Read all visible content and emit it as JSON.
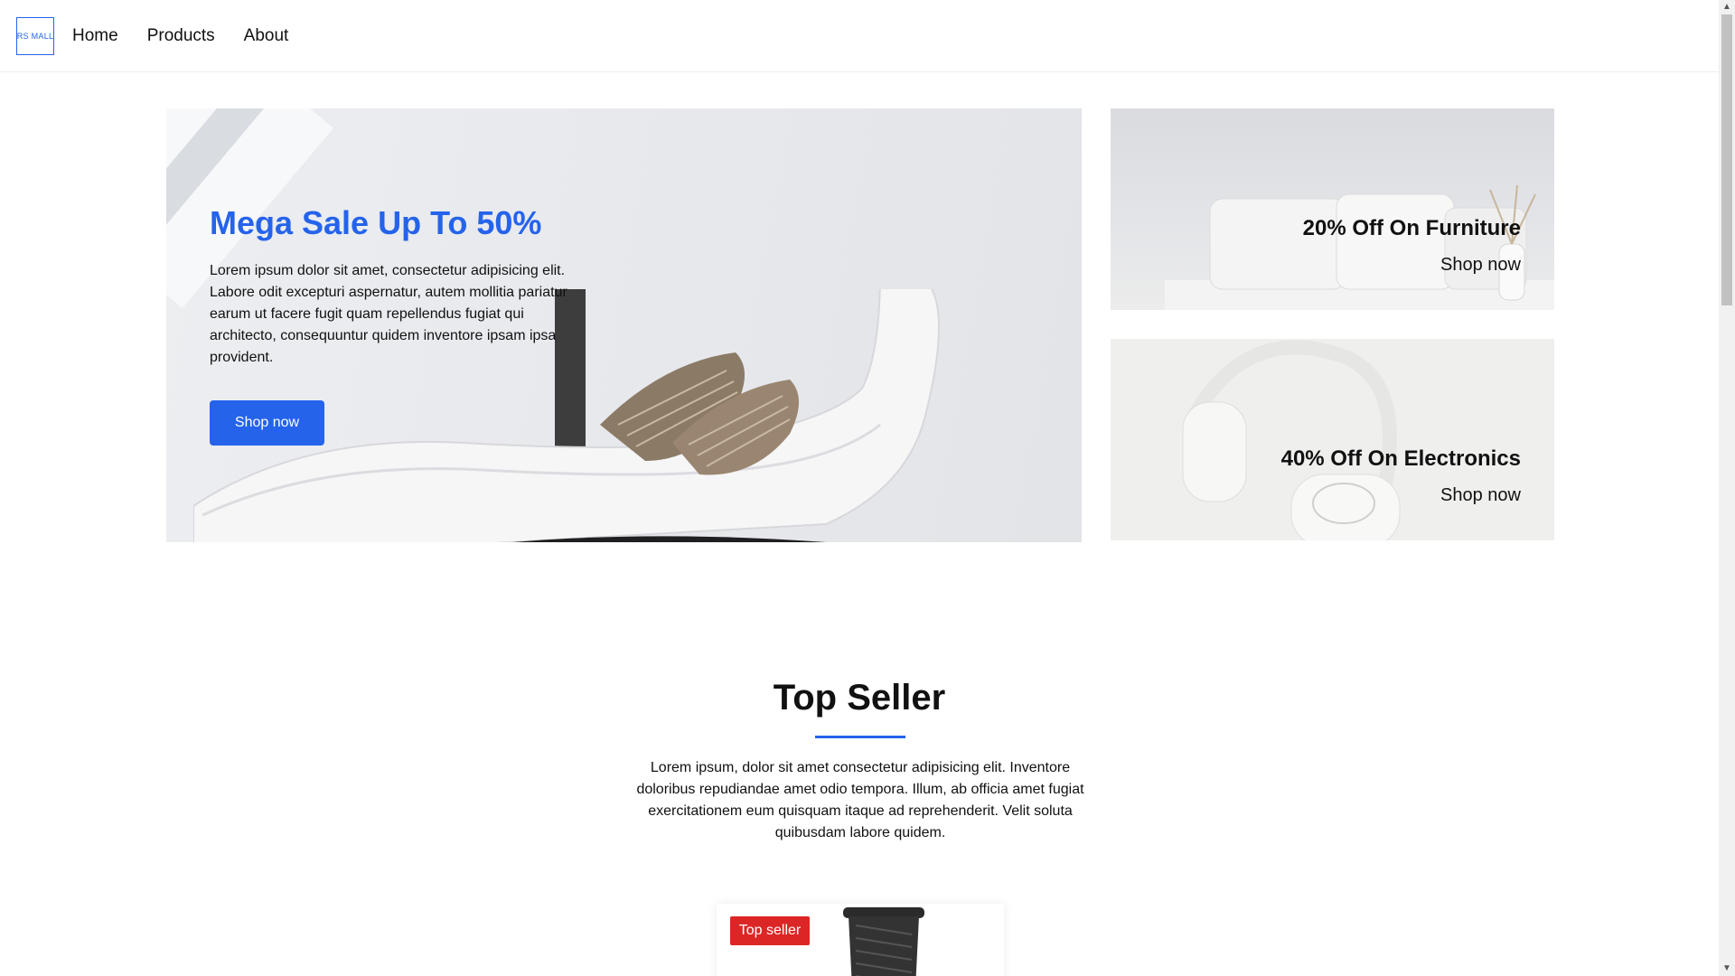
{
  "header": {
    "logo_text": "RS MALL",
    "nav": [
      "Home",
      "Products",
      "About"
    ]
  },
  "hero": {
    "title": "Mega Sale Up To 50%",
    "text": "Lorem ipsum dolor sit amet, consectetur adipisicing elit. Labore odit excepturi aspernatur, autem mollitia pariatur earum ut facere fugit quam repellendus fugiat qui architecto, consequuntur quidem inventore ipsam ipsa provident.",
    "button": "Shop now"
  },
  "promos": [
    {
      "title": "20% Off On Furniture",
      "link": "Shop now"
    },
    {
      "title": "40% Off On Electronics",
      "link": "Shop now"
    }
  ],
  "top_seller": {
    "title": "Top Seller",
    "text": "Lorem ipsum, dolor sit amet consectetur adipisicing elit. Inventore doloribus repudiandae amet odio tempora. Illum, ab officia amet fugiat exercitationem eum quisquam itaque ad reprehenderit. Velit soluta quibusdam labore quidem.",
    "badge": "Top seller"
  },
  "colors": {
    "accent": "#2563eb",
    "badge": "#dc2626"
  }
}
